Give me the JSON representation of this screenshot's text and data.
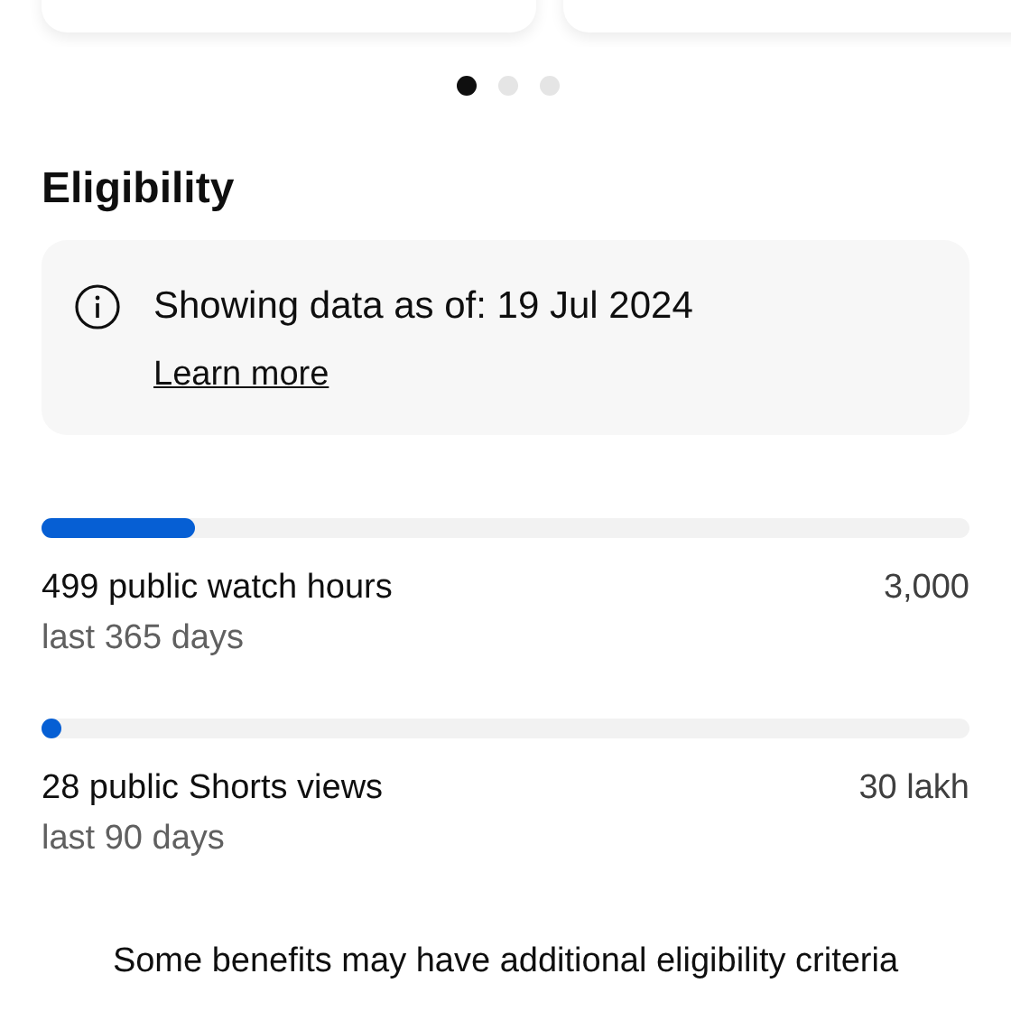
{
  "carousel": {
    "cards": [
      {
        "kind": "card"
      },
      {
        "kind": "card"
      }
    ],
    "dots": [
      {
        "selected": true
      },
      {
        "selected": false
      },
      {
        "selected": false
      }
    ]
  },
  "eligibility": {
    "title": "Eligibility",
    "notice": {
      "text": "Showing data as of: 19 Jul 2024",
      "link": "Learn more"
    },
    "metrics": [
      {
        "label": "499 public watch hours",
        "period": "last 365 days",
        "target": "3,000",
        "level": 0.166
      },
      {
        "label": "28 public Shorts views",
        "period": "last 90 days",
        "target": "30 lakh",
        "level": 0
      }
    ],
    "footer": "Some benefits may have additional eligibility criteria"
  }
}
